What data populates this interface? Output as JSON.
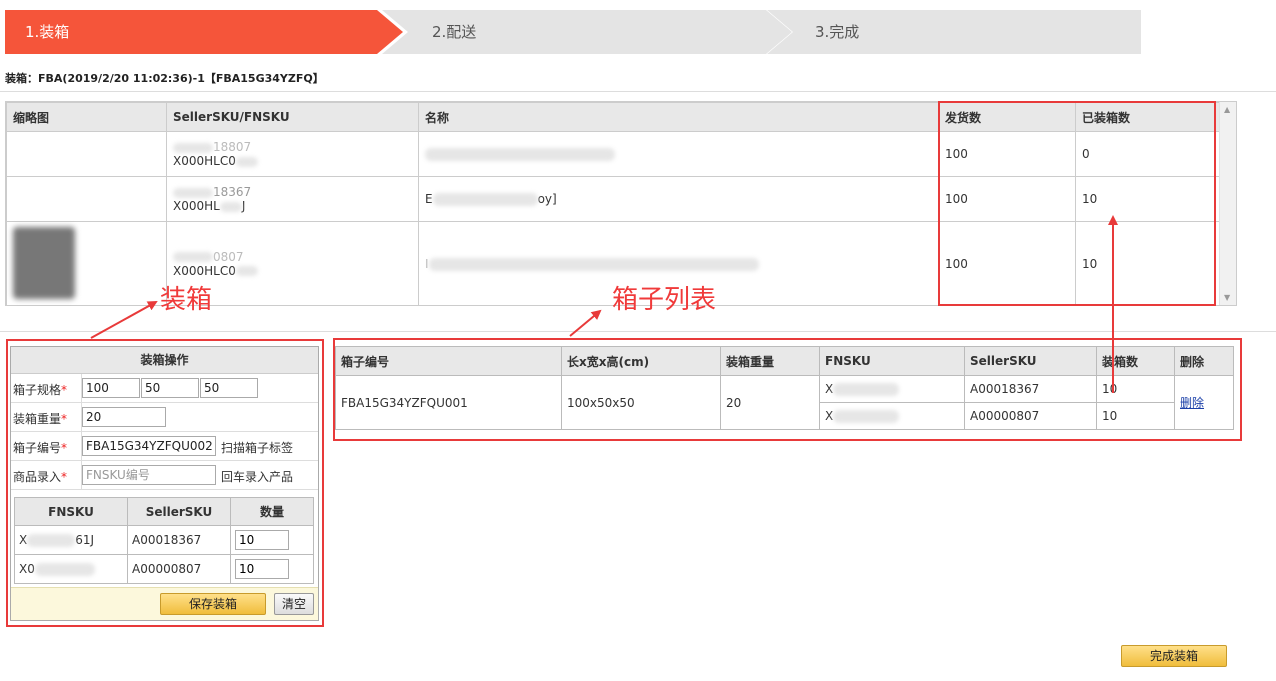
{
  "steps": [
    "1.装箱",
    "2.配送",
    "3.完成"
  ],
  "box_title": "装箱：FBA(2019/2/20 11:02:36)-1【FBA15G34YZFQ】",
  "product_table": {
    "headers": [
      "缩略图",
      "SellerSKU/FNSKU",
      "名称",
      "发货数",
      "已装箱数"
    ],
    "rows": [
      {
        "sku_line1": "18807",
        "sku_line2": "X000HLC0",
        "name_prefix": "",
        "name_suffix": "",
        "shipped": "100",
        "packed": "0"
      },
      {
        "sku_line1": "18367",
        "sku_line2": "X000HL",
        "sku_line2_tail": "J",
        "name_prefix": "E",
        "name_suffix": "oy]",
        "shipped": "100",
        "packed": "10"
      },
      {
        "sku_line1": "0807",
        "sku_line2": "X000HLC0",
        "name_prefix": "I",
        "name_suffix": "",
        "shipped": "100",
        "packed": "10"
      }
    ]
  },
  "annotations": {
    "packing": "装箱",
    "box_list": "箱子列表"
  },
  "packing_panel": {
    "title": "装箱操作",
    "box_spec_label": "箱子规格",
    "box_spec_values": [
      "100",
      "50",
      "50"
    ],
    "weight_label": "装箱重量",
    "weight_value": "20",
    "box_no_label": "箱子编号",
    "box_no_value": "FBA15G34YZFQU002",
    "box_no_hint": "扫描箱子标签",
    "item_label": "商品录入",
    "item_placeholder": "FNSKU编号",
    "item_hint": "回车录入产品",
    "items_headers": [
      "FNSKU",
      "SellerSKU",
      "数量"
    ],
    "items": [
      {
        "fnsku_prefix": "X",
        "fnsku_suffix": "61J",
        "seller_sku": "A00018367",
        "qty": "10"
      },
      {
        "fnsku_prefix": "X0",
        "fnsku_suffix": "",
        "seller_sku": "A00000807",
        "qty": "10"
      }
    ],
    "save_button": "保存装箱",
    "clear_button": "清空"
  },
  "box_list": {
    "headers": [
      "箱子编号",
      "长x宽x高(cm)",
      "装箱重量",
      "FNSKU",
      "SellerSKU",
      "装箱数",
      "删除"
    ],
    "box_no": "FBA15G34YZFQU001",
    "dims": "100x50x50",
    "weight": "20",
    "items": [
      {
        "fnsku_prefix": "X",
        "seller_sku": "A00018367",
        "qty": "10"
      },
      {
        "fnsku_prefix": "X",
        "seller_sku": "A00000807",
        "qty": "10"
      }
    ],
    "delete_link": "删除"
  },
  "finish_button": "完成装箱",
  "colors": {
    "accent": "#f5553a",
    "annotation": "#e83a3a",
    "link": "#1a3fa8"
  }
}
